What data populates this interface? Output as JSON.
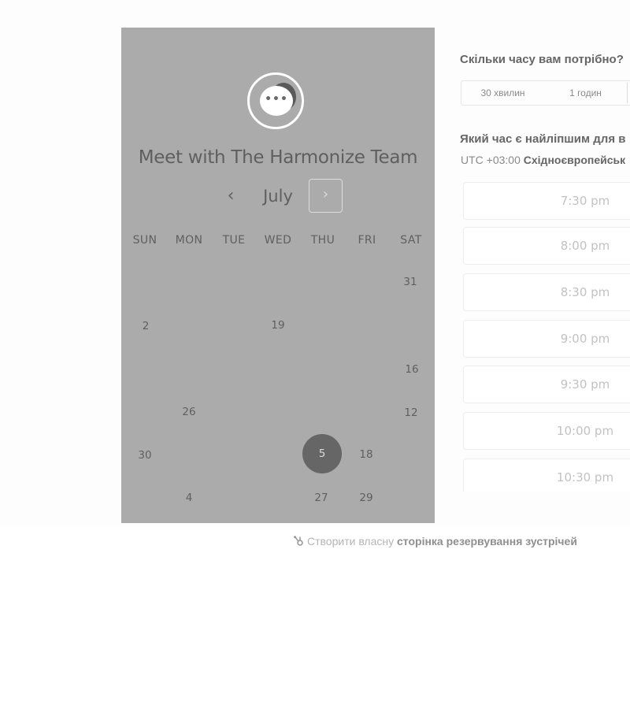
{
  "calendar": {
    "title": "Meet with The Harmonize Team",
    "month": "July",
    "prev_symbol": "‹",
    "next_symbol": "›",
    "logo_icon": "chat-bubble-icon",
    "weekdays": [
      "SUN",
      "MON",
      "TUE",
      "WED",
      "THU",
      "FRI",
      "SAT"
    ],
    "days": [
      "31",
      "2",
      "19",
      "16",
      "26",
      "12",
      "30",
      "18",
      "4",
      "27",
      "29"
    ],
    "selected_day": "5"
  },
  "duration": {
    "question": "Скільки часу вам потрібно?",
    "options": [
      "30 хвилин",
      "1 годин"
    ]
  },
  "time": {
    "question": "Який час є найліпшим для в",
    "timezone_prefix": "UTC +03:00",
    "timezone_name": "Східноєвропейськ",
    "slots": [
      "7:30 pm",
      "8:00 pm",
      "8:30 pm",
      "9:00 pm",
      "9:30 pm",
      "10:00 pm",
      "10:30 pm"
    ]
  },
  "footer": {
    "prefix": "Створити власну",
    "link": "сторінка резервування зустрічей",
    "icon": "sprocket-icon"
  },
  "colors": {
    "overlay_gray": "#ababab",
    "selected_day": "#666666",
    "slot_text": "#c2c2c2"
  }
}
